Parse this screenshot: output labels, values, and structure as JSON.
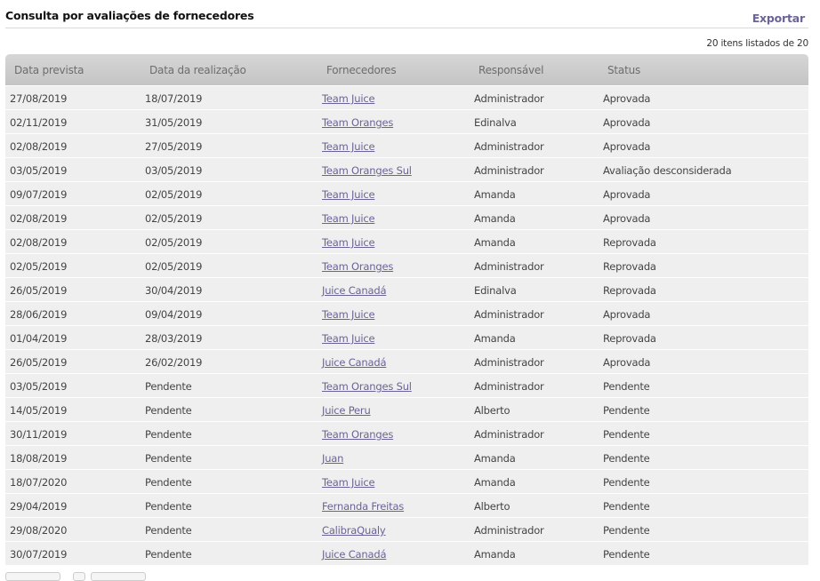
{
  "header": {
    "title": "Consulta por avaliações de fornecedores",
    "export_label": "Exportar",
    "count_text": "20 itens listados de 20"
  },
  "table": {
    "columns": [
      "Data prevista",
      "Data da realização",
      "Fornecedores",
      "Responsável",
      "Status"
    ],
    "rows": [
      [
        "27/08/2019",
        "18/07/2019",
        "Team Juice",
        "Administrador",
        "Aprovada"
      ],
      [
        "02/11/2019",
        "31/05/2019",
        "Team Oranges",
        "Edinalva",
        "Aprovada"
      ],
      [
        "02/08/2019",
        "27/05/2019",
        "Team Juice",
        "Administrador",
        "Aprovada"
      ],
      [
        "03/05/2019",
        "03/05/2019",
        "Team Oranges Sul",
        "Administrador",
        "Avaliação desconsiderada"
      ],
      [
        "09/07/2019",
        "02/05/2019",
        "Team Juice",
        "Amanda",
        "Aprovada"
      ],
      [
        "02/08/2019",
        "02/05/2019",
        "Team Juice",
        "Amanda",
        "Aprovada"
      ],
      [
        "02/08/2019",
        "02/05/2019",
        "Team Juice",
        "Amanda",
        "Reprovada"
      ],
      [
        "02/05/2019",
        "02/05/2019",
        "Team Oranges",
        "Administrador",
        "Reprovada"
      ],
      [
        "26/05/2019",
        "30/04/2019",
        "Juice Canadá",
        "Edinalva",
        "Reprovada"
      ],
      [
        "28/06/2019",
        "09/04/2019",
        "Team Juice",
        "Administrador",
        "Aprovada"
      ],
      [
        "01/04/2019",
        "28/03/2019",
        "Team Juice",
        "Amanda",
        "Reprovada"
      ],
      [
        "26/05/2019",
        "26/02/2019",
        "Juice Canadá",
        "Administrador",
        "Aprovada"
      ],
      [
        "03/05/2019",
        "Pendente",
        "Team Oranges Sul",
        "Administrador",
        "Pendente"
      ],
      [
        "14/05/2019",
        "Pendente",
        "Juice Peru",
        "Alberto",
        "Pendente"
      ],
      [
        "30/11/2019",
        "Pendente",
        "Team Oranges",
        "Administrador",
        "Pendente"
      ],
      [
        "18/08/2019",
        "Pendente",
        "Juan",
        "Amanda",
        "Pendente"
      ],
      [
        "18/07/2020",
        "Pendente",
        "Team Juice",
        "Amanda",
        "Pendente"
      ],
      [
        "29/04/2019",
        "Pendente",
        "Fernanda Freitas",
        "Alberto",
        "Pendente"
      ],
      [
        "29/08/2020",
        "Pendente",
        "CalibraQualy",
        "Administrador",
        "Pendente"
      ],
      [
        "30/07/2019",
        "Pendente",
        "Juice Canadá",
        "Amanda",
        "Pendente"
      ]
    ]
  }
}
